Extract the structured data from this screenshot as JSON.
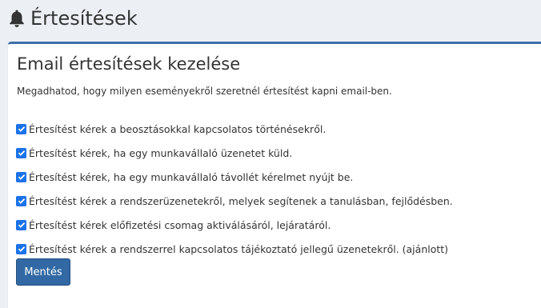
{
  "header": {
    "icon": "bell-icon",
    "title": "Értesítések"
  },
  "card": {
    "accent_color": "#3c6ea8",
    "title": "Email értesítések kezelése",
    "description": "Megadhatod, hogy milyen eseményekről szeretnél értesítést kapni email-ben.",
    "options": [
      {
        "label": "Értesítést kérek a beosztásokkal kapcsolatos történésekről.",
        "checked": true
      },
      {
        "label": "Értesítést kérek, ha egy munkavállaló üzenetet küld.",
        "checked": true
      },
      {
        "label": "Értesítést kérek, ha egy munkavállaló távollét kérelmet nyújt be.",
        "checked": true
      },
      {
        "label": "Értesítést kérek a rendszerüzenetekről, melyek segítenek a tanulásban, fejlődésben.",
        "checked": true
      },
      {
        "label": "Értesítést kérek előfizetési csomag aktiválásáról, lejáratáról.",
        "checked": true
      },
      {
        "label": "Értesítést kérek a rendszerrel kapcsolatos tájékoztató jellegű üzenetekről. (ajánlott)",
        "checked": true
      }
    ],
    "save_label": "Mentés",
    "save_color": "#3269a4"
  }
}
